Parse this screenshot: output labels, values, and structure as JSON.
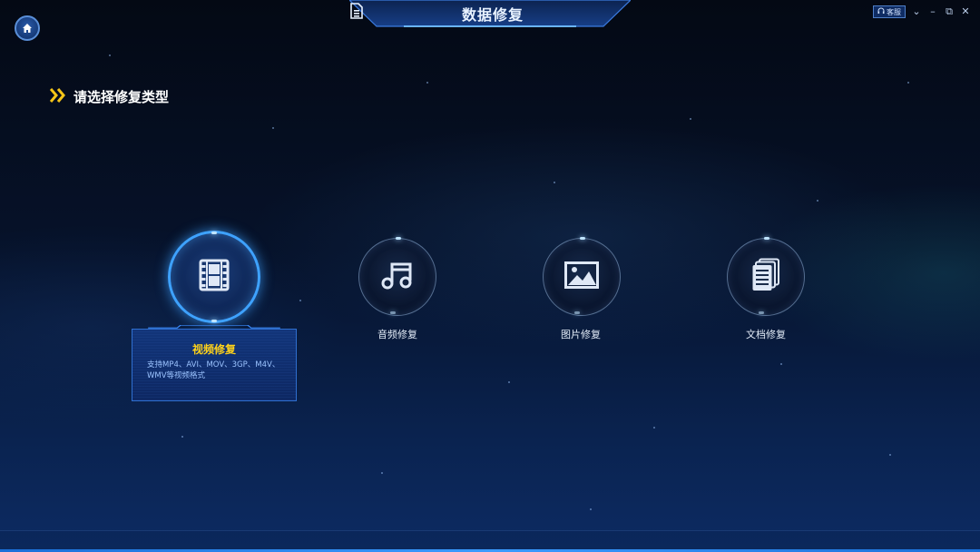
{
  "window": {
    "title": "数据修复",
    "service_label": "客服",
    "controls": {
      "menu": "⌄",
      "minimize": "–",
      "restore": "⧉",
      "close": "✕"
    }
  },
  "heading": "请选择修复类型",
  "icons": {
    "home": "home-icon",
    "title": "document-icon",
    "heading": "double-chevron-icon",
    "service": "headset-icon",
    "video": "film-icon",
    "audio": "music-note-icon",
    "image": "picture-icon",
    "document": "document-stack-icon"
  },
  "repair_types": [
    {
      "label": "视频修复",
      "description": "支持MP4、AVI、MOV、3GP、M4V、WMV等视频格式",
      "selected": true
    },
    {
      "label": "音频修复",
      "selected": false
    },
    {
      "label": "图片修复",
      "selected": false
    },
    {
      "label": "文档修复",
      "selected": false
    }
  ],
  "colors": {
    "accent": "#3ea2ff",
    "highlight_title": "#ffd21a",
    "heading_chevron": "#f5c518",
    "background_top": "#040914",
    "background_bottom": "#0d2b63"
  }
}
